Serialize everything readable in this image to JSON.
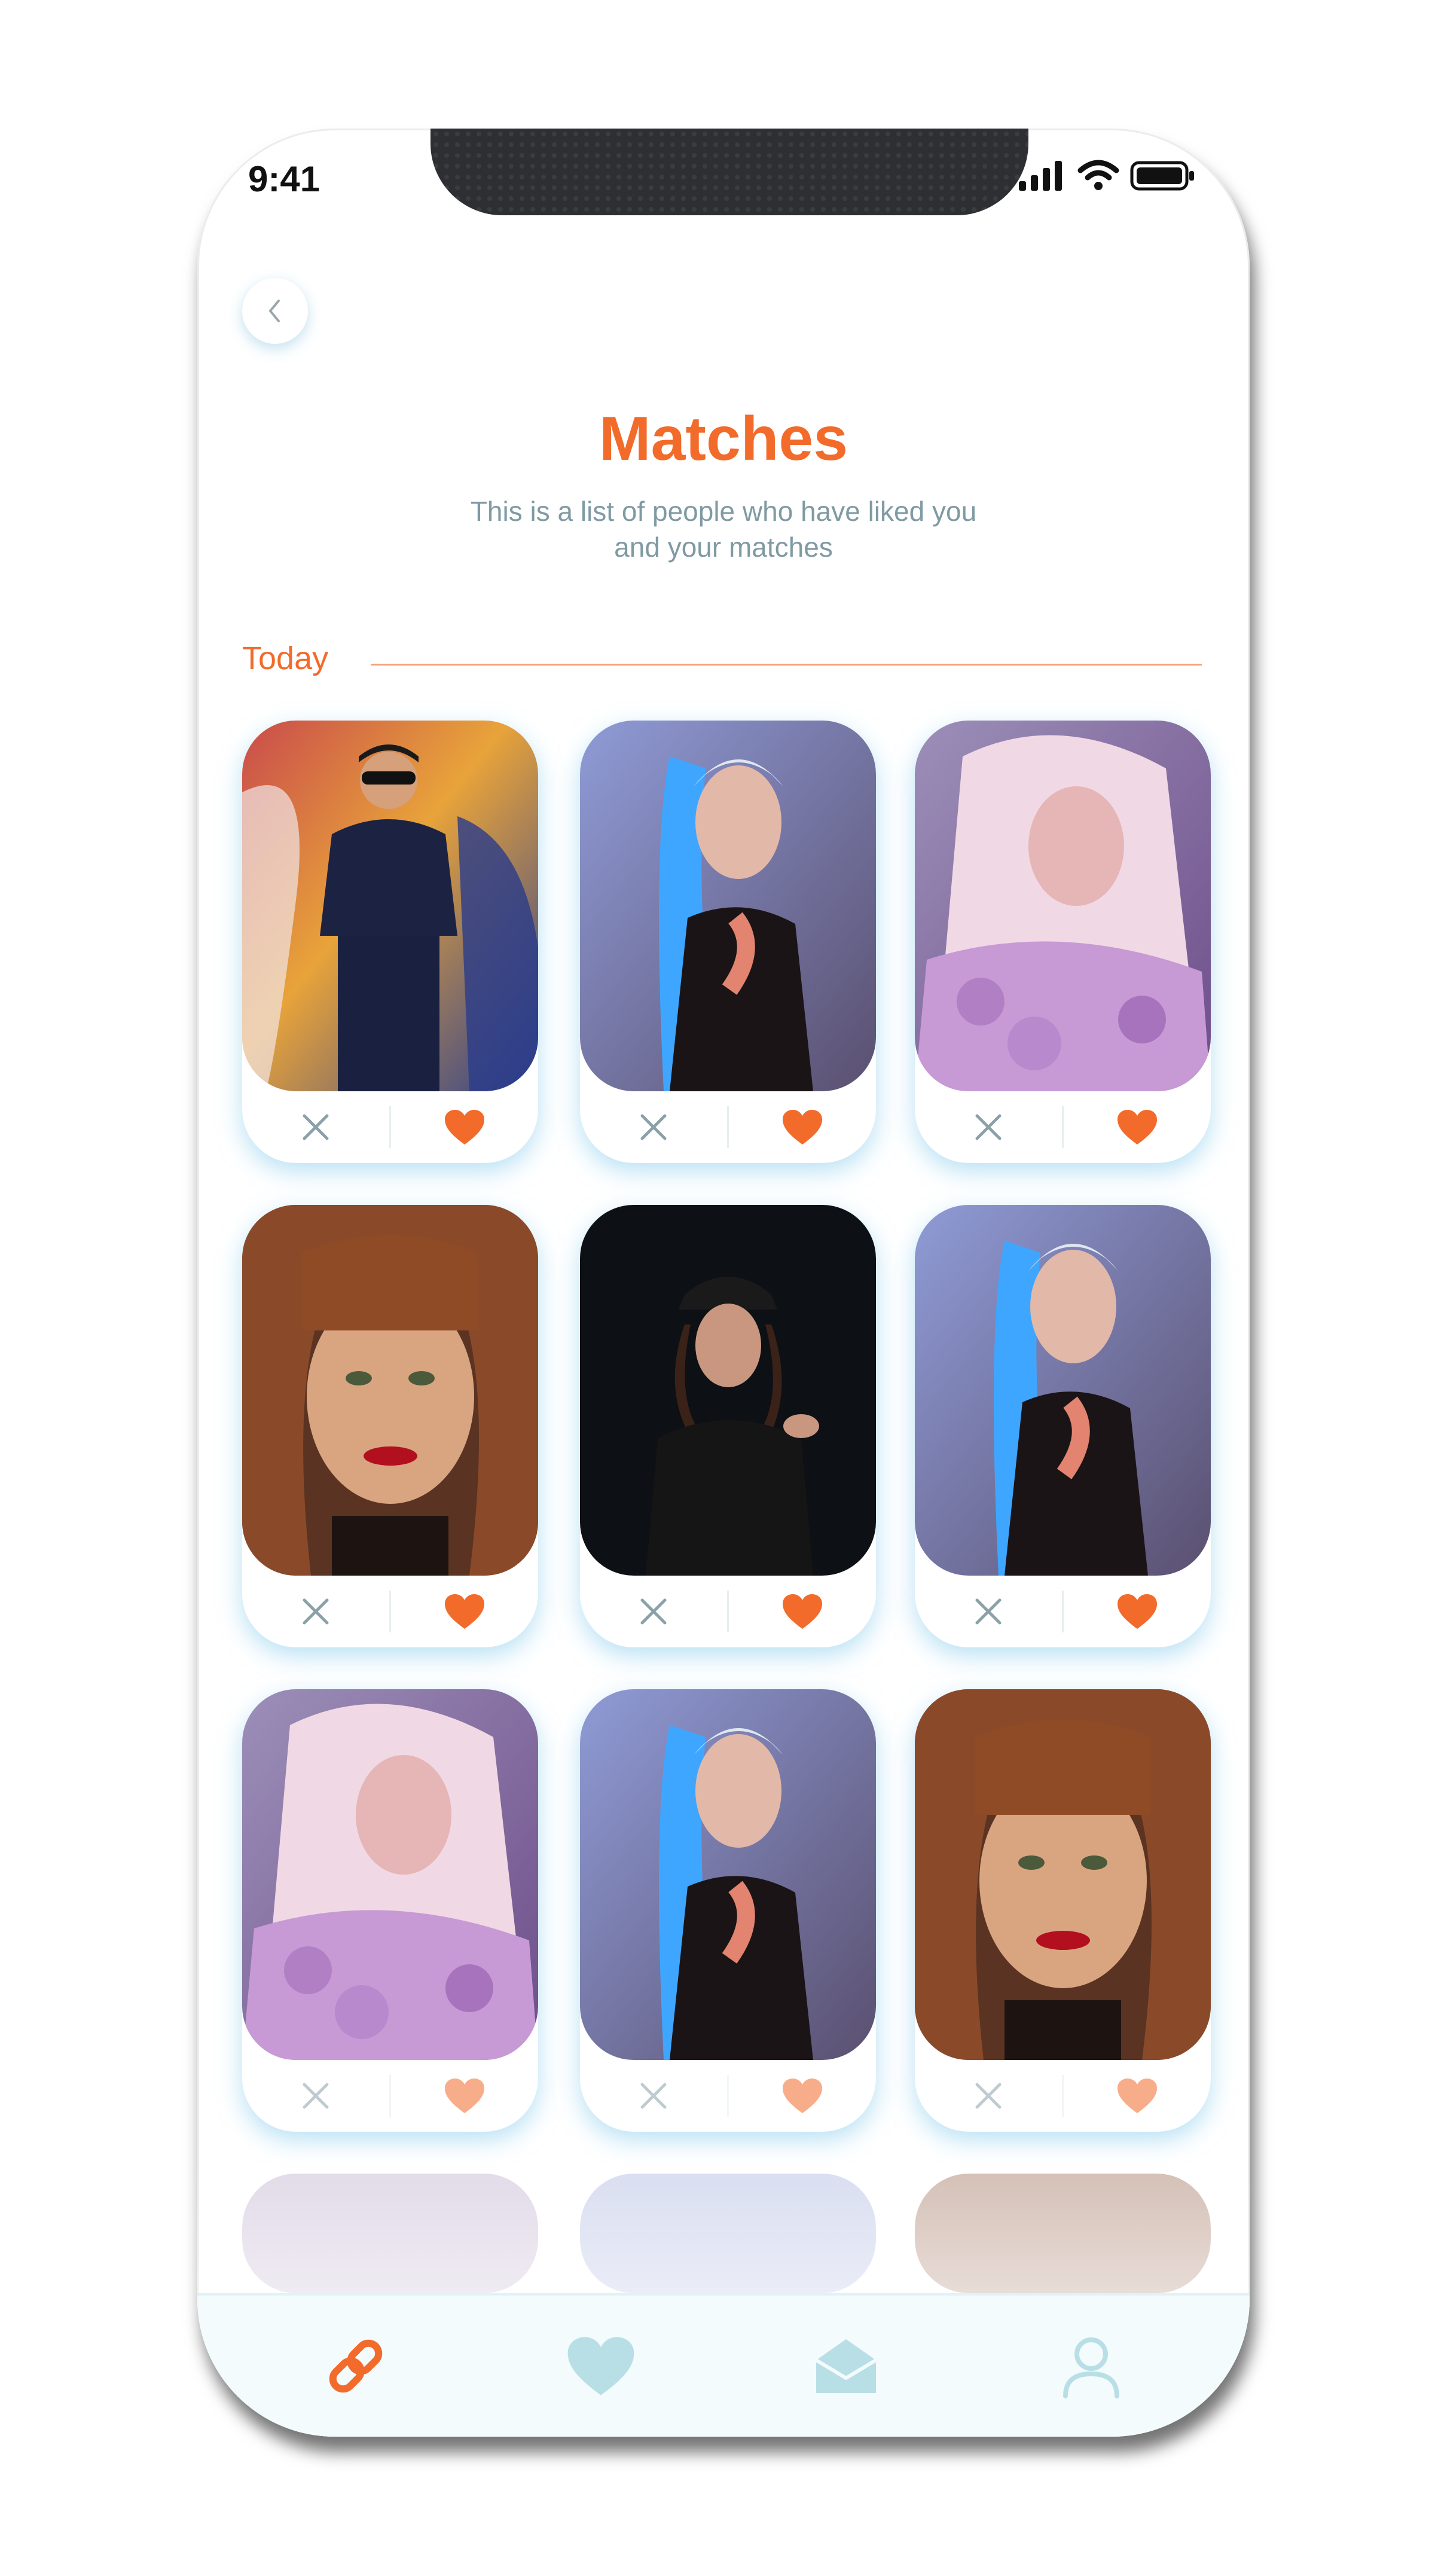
{
  "status_bar": {
    "time": "9:41"
  },
  "header": {
    "title": "Matches",
    "subtitle_line1": "This is a list of people who have liked you",
    "subtitle_line2": "and your matches"
  },
  "section": {
    "label": "Today"
  },
  "colors": {
    "accent": "#f26b2a",
    "muted": "#7f9aa3",
    "tab_inactive": "#b9dfe6"
  },
  "cards": [
    {
      "photo": "woman-sunglasses-graffiti",
      "dislike_icon": "close-icon",
      "like_icon": "heart-icon"
    },
    {
      "photo": "woman-blonde-blue-red-light",
      "dislike_icon": "close-icon",
      "like_icon": "heart-icon"
    },
    {
      "photo": "woman-blonde-pink-fur",
      "dislike_icon": "close-icon",
      "like_icon": "heart-icon"
    },
    {
      "photo": "woman-auburn-bangs",
      "dislike_icon": "close-icon",
      "like_icon": "heart-icon"
    },
    {
      "photo": "woman-black-hat-dark",
      "dislike_icon": "close-icon",
      "like_icon": "heart-icon"
    },
    {
      "photo": "woman-blonde-blue-red-light",
      "dislike_icon": "close-icon",
      "like_icon": "heart-icon"
    },
    {
      "photo": "woman-blonde-pink-fur",
      "dislike_icon": "close-icon",
      "like_icon": "heart-icon"
    },
    {
      "photo": "woman-blonde-blue-red-light",
      "dislike_icon": "close-icon",
      "like_icon": "heart-icon"
    },
    {
      "photo": "woman-auburn-bangs",
      "dislike_icon": "close-icon",
      "like_icon": "heart-icon"
    }
  ],
  "tabbar": {
    "items": [
      {
        "icon": "link-icon",
        "active": true
      },
      {
        "icon": "heart-icon",
        "active": false
      },
      {
        "icon": "mail-icon",
        "active": false
      },
      {
        "icon": "user-icon",
        "active": false
      }
    ]
  }
}
